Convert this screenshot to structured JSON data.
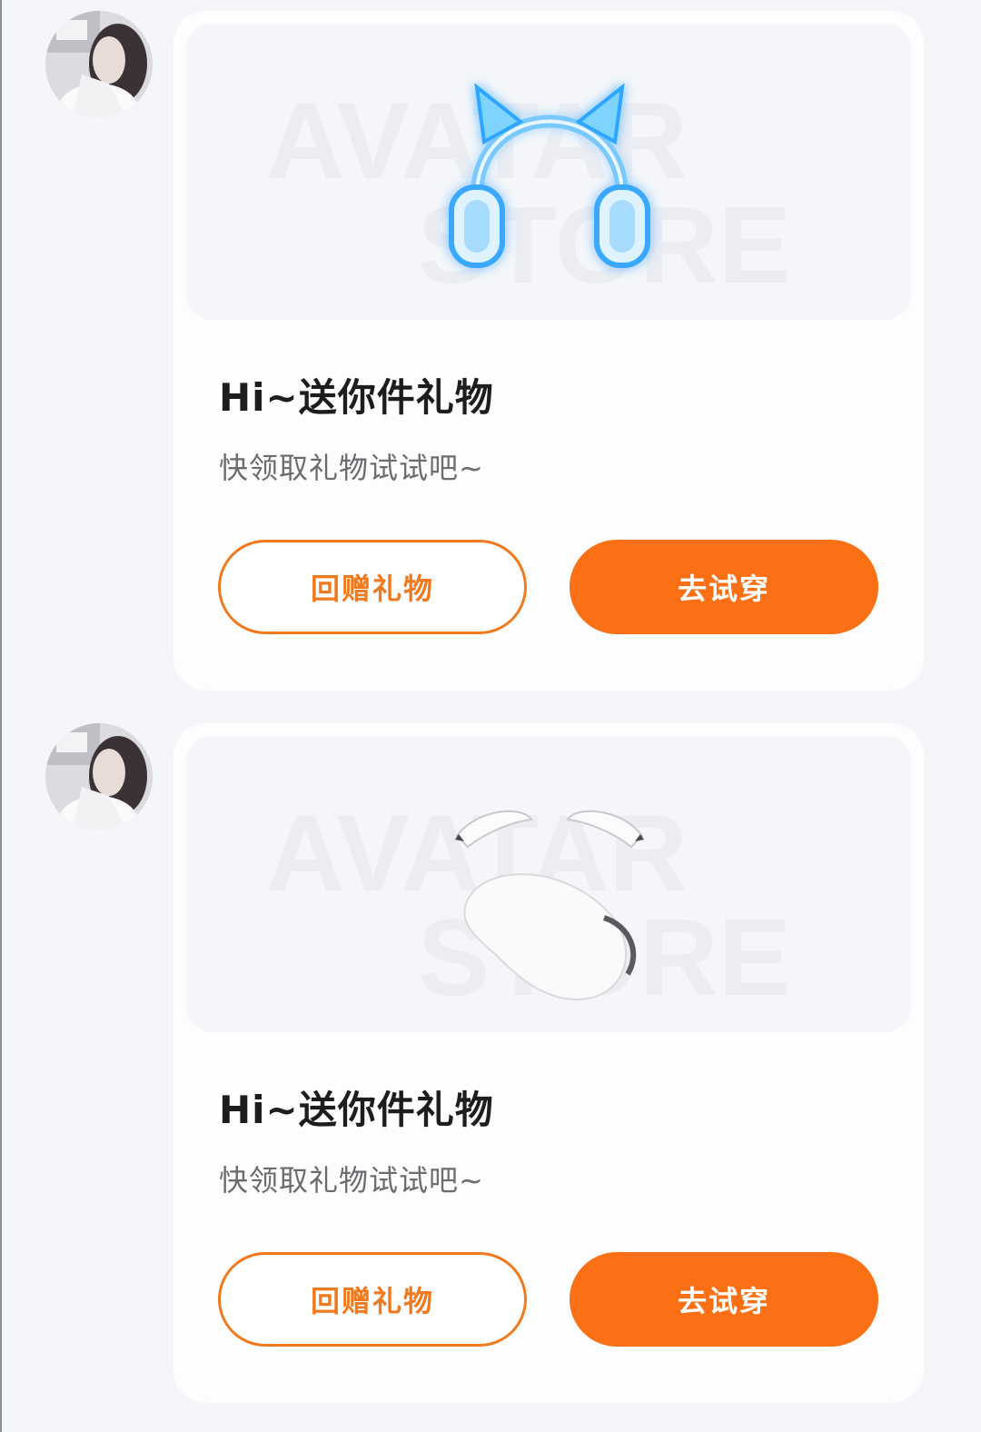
{
  "messages": [
    {
      "title": "Hi~送你件礼物",
      "subtitle": "快领取礼物试试吧~",
      "gift_icon": "cat-ear-headphones-icon",
      "watermark_line1": "AVATAR",
      "watermark_line2": "STORE",
      "return_gift_label": "回赠礼物",
      "try_on_label": "去试穿"
    },
    {
      "title": "Hi~送你件礼物",
      "subtitle": "快领取礼物试试吧~",
      "gift_icon": "brows-and-mustache-icon",
      "watermark_line1": "AVATAR",
      "watermark_line2": "STORE",
      "return_gift_label": "回赠礼物",
      "try_on_label": "去试穿"
    }
  ],
  "colors": {
    "accent": "#fb7014",
    "accent_outline": "#f07a1f",
    "page_bg": "#f5f6fa",
    "card_bg": "#fdfdfe",
    "title": "#1d1d1f",
    "subtitle": "#6c6c70"
  }
}
